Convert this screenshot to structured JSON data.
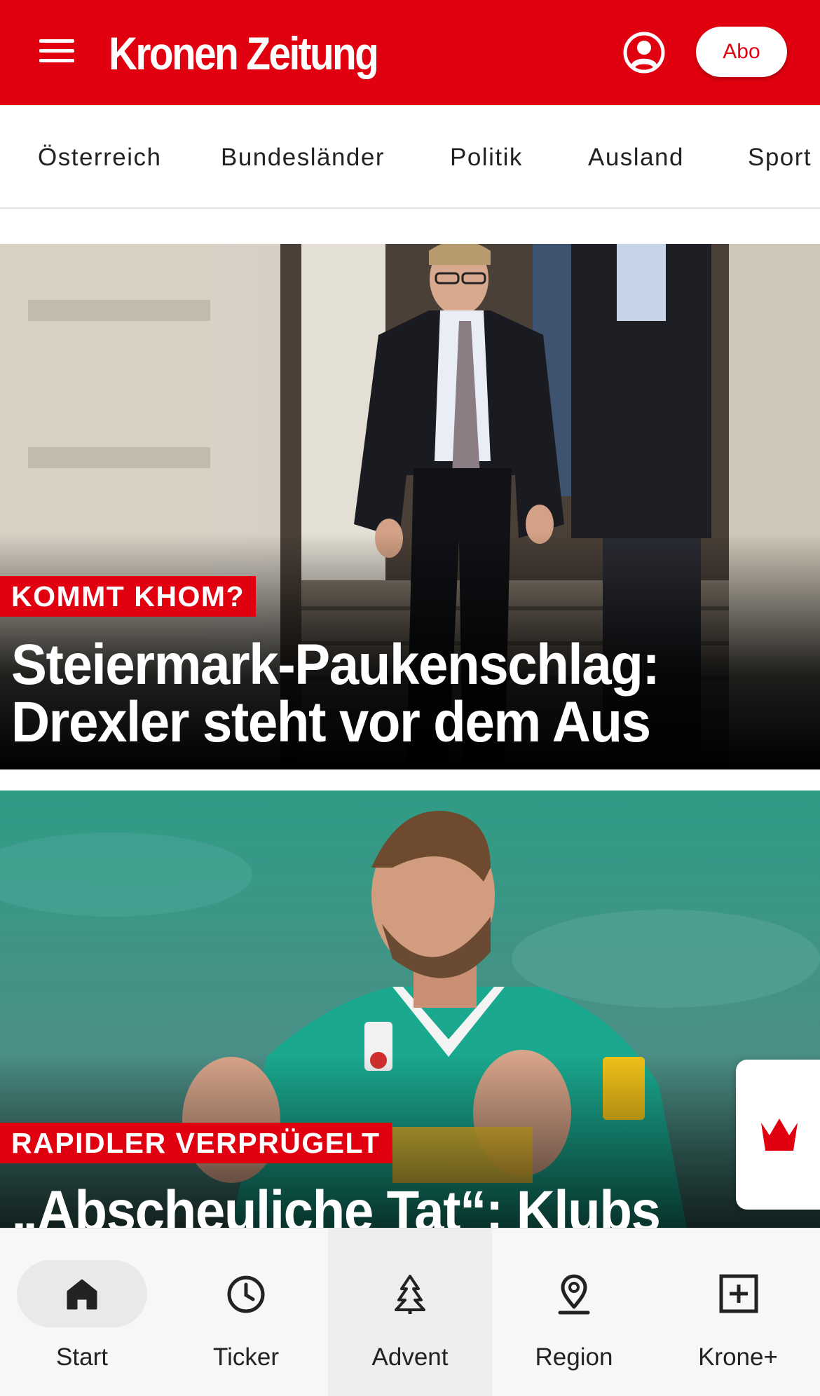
{
  "header": {
    "logo_text": "Kronen Zeitung",
    "abo_label": "Abo",
    "brand_color": "#e1000f",
    "menu_icon": "hamburger-menu-icon",
    "account_icon": "user-account-icon"
  },
  "nav": {
    "items": [
      "Österreich",
      "Bundesländer",
      "Politik",
      "Ausland",
      "Sport"
    ]
  },
  "articles": [
    {
      "kicker": "KOMMT KHOM?",
      "headline": "Steiermark-Paukenschlag: Drexler steht vor dem Aus",
      "image": "politician-walking-down-stairs-photo"
    },
    {
      "kicker": "RAPIDLER VERPRÜGELT",
      "headline": "„Abscheuliche Tat“: Klubs",
      "image": "soccer-player-green-jersey-photo"
    }
  ],
  "floating_widget": {
    "icon": "crown-icon"
  },
  "bottom_nav": {
    "tabs": [
      {
        "label": "Start",
        "icon": "home-icon",
        "active": true
      },
      {
        "label": "Ticker",
        "icon": "clock-icon"
      },
      {
        "label": "Advent",
        "icon": "christmas-tree-icon"
      },
      {
        "label": "Region",
        "icon": "location-pin-icon"
      },
      {
        "label": "Krone+",
        "icon": "plus-box-icon"
      }
    ]
  }
}
